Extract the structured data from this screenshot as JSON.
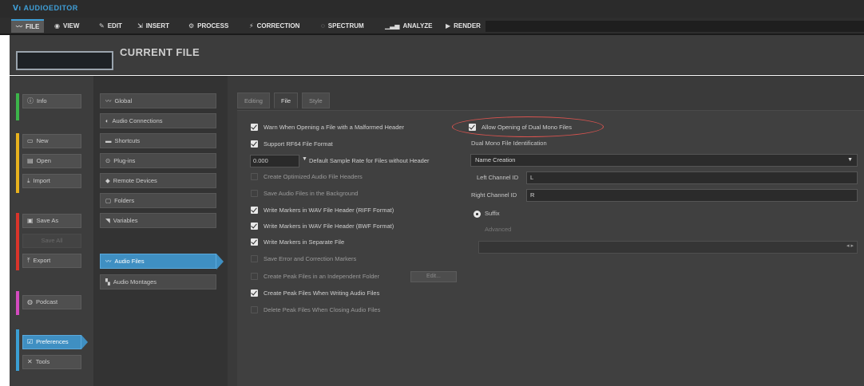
{
  "app": {
    "title": "AUDIOEDITOR"
  },
  "menu": [
    {
      "label": "FILE",
      "icon": "wave-icon",
      "glyph": "〰"
    },
    {
      "label": "VIEW",
      "icon": "eye-icon",
      "glyph": "◉"
    },
    {
      "label": "EDIT",
      "icon": "edit-icon",
      "glyph": "✎"
    },
    {
      "label": "INSERT",
      "icon": "insert-icon",
      "glyph": "⇲"
    },
    {
      "label": "PROCESS",
      "icon": "process-icon",
      "glyph": "⚙"
    },
    {
      "label": "CORRECTION",
      "icon": "correction-icon",
      "glyph": "⚡"
    },
    {
      "label": "SPECTRUM",
      "icon": "spectrum-icon",
      "glyph": "◌"
    },
    {
      "label": "ANALYZE",
      "icon": "analyze-icon",
      "glyph": "▁▃▅"
    },
    {
      "label": "RENDER",
      "icon": "render-icon",
      "glyph": "▶"
    }
  ],
  "header": {
    "title": "CURRENT FILE",
    "file_box_value": ""
  },
  "nav": [
    {
      "label": "Info",
      "icon": "info-icon",
      "glyph": "ⓘ"
    },
    {
      "label": "New",
      "icon": "new-icon",
      "glyph": "▭"
    },
    {
      "label": "Open",
      "icon": "open-icon",
      "glyph": "▤"
    },
    {
      "label": "Import",
      "icon": "import-icon",
      "glyph": "⤓"
    },
    {
      "label": "Save As",
      "icon": "save-as-icon",
      "glyph": "▣"
    },
    {
      "label": "Save All",
      "icon": "",
      "glyph": ""
    },
    {
      "label": "Export",
      "icon": "export-icon",
      "glyph": "⤒"
    },
    {
      "label": "Podcast",
      "icon": "podcast-icon",
      "glyph": "◍"
    },
    {
      "label": "Preferences",
      "icon": "preferences-icon",
      "glyph": "☑"
    },
    {
      "label": "Tools",
      "icon": "tools-icon",
      "glyph": "✕"
    }
  ],
  "strip_colors": {
    "green": "#3cb54a",
    "yellow": "#e8b21e",
    "red": "#d9342b",
    "pink": "#d44bbf",
    "blue": "#3b9fd4"
  },
  "categories": [
    {
      "label": "Global",
      "icon": "global-icon",
      "glyph": "〰"
    },
    {
      "label": "Audio Connections",
      "icon": "audio-connections-icon",
      "glyph": "◐"
    },
    {
      "label": "Shortcuts",
      "icon": "keyboard-icon",
      "glyph": "▬"
    },
    {
      "label": "Plug-ins",
      "icon": "plug-ins-icon",
      "glyph": "⊙"
    },
    {
      "label": "Remote Devices",
      "icon": "remote-devices-icon",
      "glyph": "◆"
    },
    {
      "label": "Folders",
      "icon": "folder-icon",
      "glyph": "▢"
    },
    {
      "label": "Variables",
      "icon": "variables-icon",
      "glyph": "◥"
    },
    {
      "label": "Audio Files",
      "icon": "audio-files-icon",
      "glyph": "〰"
    },
    {
      "label": "Audio Montages",
      "icon": "audio-montages-icon",
      "glyph": "▚"
    }
  ],
  "tabs": [
    {
      "label": "Editing"
    },
    {
      "label": "File"
    },
    {
      "label": "Style"
    }
  ],
  "file_settings": {
    "warn_malformed": "Warn When Opening a File with a Malformed Header",
    "support_rf64": "Support RF64 File Format",
    "default_rate_value": "0.000",
    "default_rate_label": "Default Sample Rate for Files without Header",
    "optimized_headers": "Create Optimized Audio File Headers",
    "save_background": "Save Audio Files in the Background",
    "markers_riff": "Write Markers in WAV File Header (RIFF Format)",
    "markers_bwf": "Write Markers in WAV File Header (BWF Format)",
    "markers_separate": "Write Markers in Separate File",
    "save_error_markers": "Save Error and Correction Markers",
    "peak_independent": "Create Peak Files in an Independent Folder",
    "peak_button": "Edit...",
    "peak_writing": "Create Peak Files When Writing Audio Files",
    "peak_delete": "Delete Peak Files When Closing Audio Files"
  },
  "dual_mono": {
    "allow_label": "Allow Opening of Dual Mono Files",
    "section_label": "Dual Mono File Identification",
    "mode_value": "Name Creation",
    "left_label": "Left Channel ID",
    "left_value": "L",
    "right_label": "Right Channel ID",
    "right_value": "R",
    "suffix_label": "Suffix",
    "advanced_label": "Advanced"
  },
  "highlight_color": "#d9534f",
  "accent_color": "#3f8fc2"
}
